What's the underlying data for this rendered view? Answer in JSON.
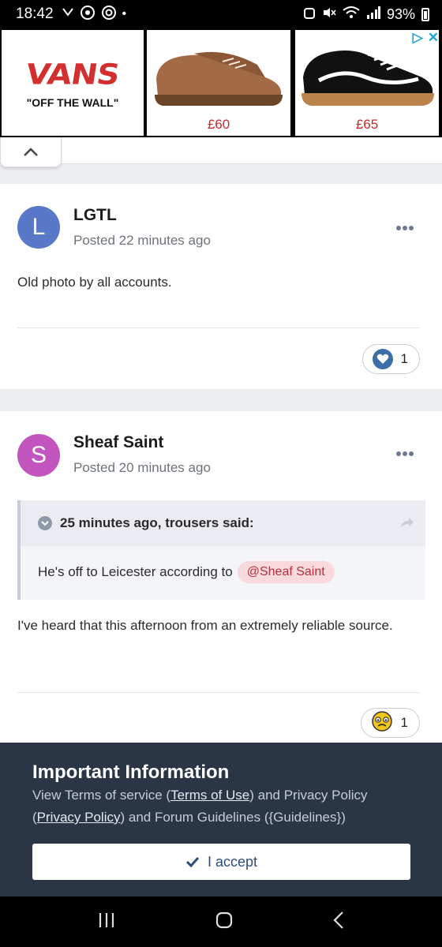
{
  "status_bar": {
    "time": "18:42",
    "battery": "93%",
    "icons": [
      "missed-call-icon",
      "whatsapp-icon",
      "chrome-icon",
      "dot-icon",
      "alarm-icon",
      "mute-icon",
      "wifi-icon",
      "signal-icon",
      "battery-icon"
    ]
  },
  "ad": {
    "brand": "VANS",
    "tagline": "\"OFF THE WALL\"",
    "products": [
      {
        "price": "£60",
        "color": "#a26a45"
      },
      {
        "price": "£65",
        "color": "#111111"
      }
    ],
    "choices": "▷",
    "close": "✕"
  },
  "posts": [
    {
      "avatar_letter": "L",
      "avatar_color": "#5a78c8",
      "author": "LGTL",
      "meta": "Posted 22 minutes ago",
      "body": "Old photo by all accounts.",
      "reaction_count": "1",
      "reaction_icon": "heart-icon"
    },
    {
      "avatar_letter": "S",
      "avatar_color": "#c356be",
      "author": "Sheaf Saint",
      "meta": "Posted 20 minutes ago",
      "quote": {
        "header": "25 minutes ago, trousers said:",
        "text": "He's off to Leicester according to",
        "mention": "@Sheaf Saint"
      },
      "body": "I've heard that this afternoon from an extremely reliable source.",
      "reaction_count": "1",
      "reaction_icon": "confused-emoji-icon"
    }
  ],
  "notice": {
    "title": "Important Information",
    "text_1": "View Terms of service (",
    "link_terms": "Terms of Use",
    "text_2": ") and Privacy Policy (",
    "link_privacy": "Privacy Policy",
    "text_3": ") and Forum Guidelines ({Guidelines})",
    "accept_label": "I accept"
  }
}
